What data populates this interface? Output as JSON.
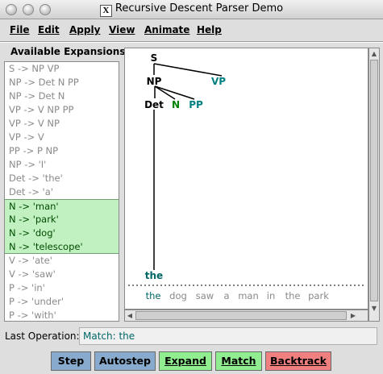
{
  "window": {
    "title": "Recursive Descent Parser Demo",
    "x_logo": "X"
  },
  "menu": {
    "file": "File",
    "edit": "Edit",
    "apply": "Apply",
    "view": "View",
    "animate": "Animate",
    "help": "Help"
  },
  "expansions": {
    "title": "Available Expansions",
    "items": [
      "S -> NP VP",
      "NP -> Det N PP",
      "NP -> Det N",
      "VP -> V NP PP",
      "VP -> V NP",
      "VP -> V",
      "PP -> P NP",
      "NP -> 'I'",
      "Det -> 'the'",
      "Det -> 'a'",
      "N -> 'man'",
      "N -> 'park'",
      "N -> 'dog'",
      "N -> 'telescope'",
      "V -> 'ate'",
      "V -> 'saw'",
      "P -> 'in'",
      "P -> 'under'",
      "P -> 'with'"
    ],
    "highlighted": [
      10,
      11,
      12,
      13
    ]
  },
  "tree": {
    "root": "S",
    "np": "NP",
    "vp": "VP",
    "det": "Det",
    "n": "N",
    "pp": "PP",
    "leaf": "the"
  },
  "sentence": {
    "words": [
      "the",
      "dog",
      "saw",
      "a",
      "man",
      "in",
      "the",
      "park"
    ],
    "matched_count": 1
  },
  "last_operation": {
    "label": "Last Operation:",
    "value": "Match: the"
  },
  "buttons": {
    "step": "Step",
    "autostep": "Autostep",
    "expand": "Expand",
    "match": "Match",
    "backtrack": "Backtrack"
  },
  "colors": {
    "matched": "#006666",
    "unmatched": "#8a8a8a",
    "frontier": "#008080",
    "highlight": "#c1f0c1"
  }
}
